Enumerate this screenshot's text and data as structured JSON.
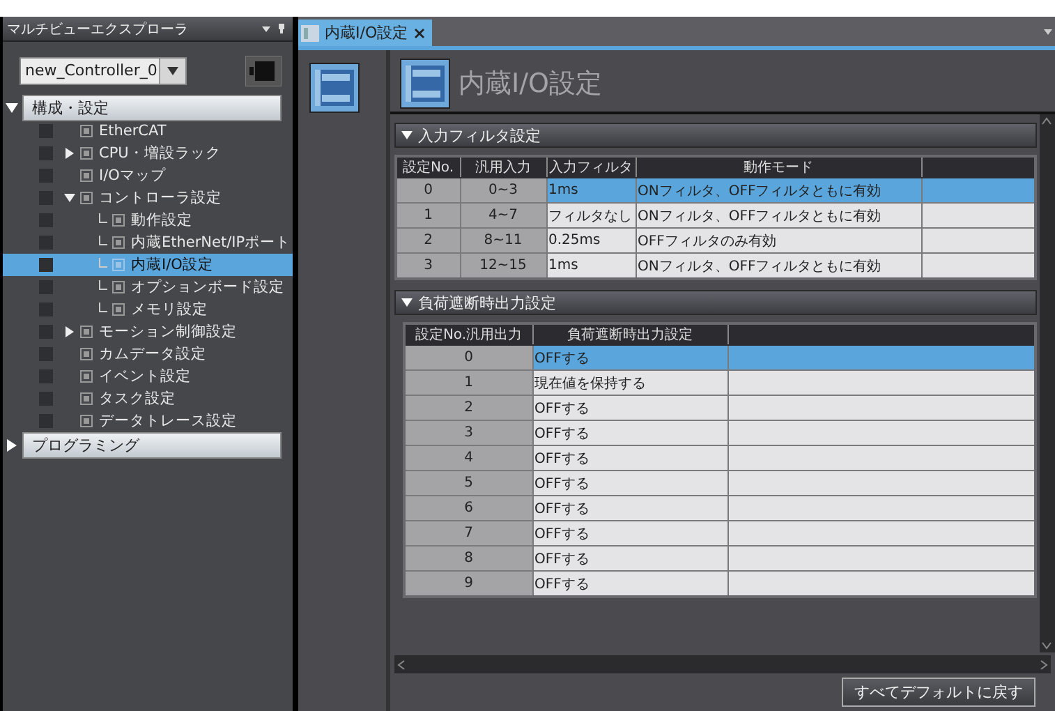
{
  "explorer": {
    "title": "マルチビューエクスプローラ",
    "controller": "new_Controller_0",
    "tree": [
      {
        "label": "構成・設定",
        "expanded": true,
        "kind": "group",
        "children": [
          {
            "label": "EtherCAT"
          },
          {
            "label": "CPU・増設ラック",
            "expanded": false
          },
          {
            "label": "I/Oマップ"
          },
          {
            "label": "コントローラ設定",
            "expanded": true,
            "children": [
              {
                "label": "動作設定",
                "selected": false
              },
              {
                "label": "内蔵EtherNet/IPポート",
                "selected": false
              },
              {
                "label": "内蔵I/O設定",
                "selected": true
              },
              {
                "label": "オプションボード設定",
                "selected": false
              },
              {
                "label": "メモリ設定",
                "selected": false
              }
            ]
          },
          {
            "label": "モーション制御設定",
            "expanded": false
          },
          {
            "label": "カムデータ設定"
          },
          {
            "label": "イベント設定"
          },
          {
            "label": "タスク設定"
          },
          {
            "label": "データトレース設定"
          }
        ]
      },
      {
        "label": "プログラミング",
        "expanded": false,
        "kind": "group"
      }
    ]
  },
  "tabs": [
    {
      "label": "内蔵I/O設定",
      "selected": true
    }
  ],
  "page_title": "内蔵I/O設定",
  "input_filter": {
    "title": "入力フィルタ設定",
    "expanded": true,
    "columns": [
      "設定No.",
      "汎用入力",
      "入力フィルタ",
      "動作モード"
    ],
    "rows": [
      {
        "cells": [
          "0",
          "0~3",
          "1ms",
          "ONフィルタ、OFFフィルタともに有効"
        ],
        "selected": true
      },
      {
        "cells": [
          "1",
          "4~7",
          "フィルタなし",
          "ONフィルタ、OFFフィルタともに有効"
        ],
        "selected": false
      },
      {
        "cells": [
          "2",
          "8~11",
          "0.25ms",
          "OFFフィルタのみ有効"
        ],
        "selected": false
      },
      {
        "cells": [
          "3",
          "12~15",
          "1ms",
          "ONフィルタ、OFFフィルタともに有効"
        ],
        "selected": false
      }
    ]
  },
  "load_off_output": {
    "title": "負荷遮断時出力設定",
    "expanded": true,
    "columns": [
      "設定No.汎用出力",
      "負荷遮断時出力設定"
    ],
    "rows": [
      {
        "cells": [
          "0",
          "OFFする"
        ],
        "selected": true
      },
      {
        "cells": [
          "1",
          "現在値を保持する"
        ],
        "selected": false
      },
      {
        "cells": [
          "2",
          "OFFする"
        ],
        "selected": false
      },
      {
        "cells": [
          "3",
          "OFFする"
        ],
        "selected": false
      },
      {
        "cells": [
          "4",
          "OFFする"
        ],
        "selected": false
      },
      {
        "cells": [
          "5",
          "OFFする"
        ],
        "selected": false
      },
      {
        "cells": [
          "6",
          "OFFする"
        ],
        "selected": false
      },
      {
        "cells": [
          "7",
          "OFFする"
        ],
        "selected": false
      },
      {
        "cells": [
          "8",
          "OFFする"
        ],
        "selected": false
      },
      {
        "cells": [
          "9",
          "OFFする"
        ],
        "selected": false
      }
    ]
  },
  "reset_button": "すべてデフォルトに戻す"
}
